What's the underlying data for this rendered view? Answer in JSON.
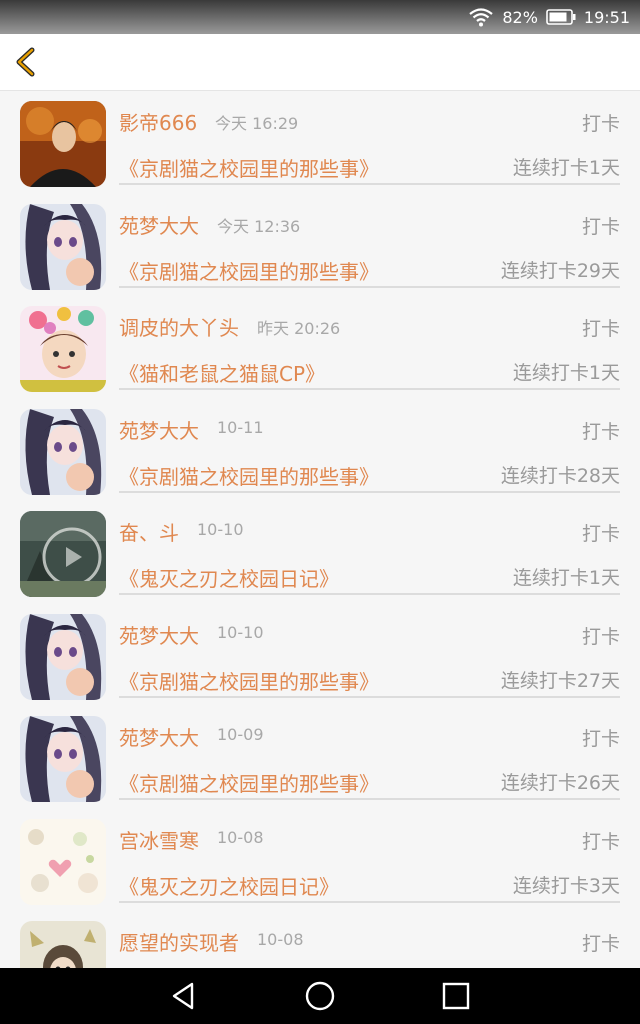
{
  "status": {
    "battery": "82%",
    "time": "19:51"
  },
  "header": {
    "back_icon": "chevron-left-icon",
    "accent": "#e8a000"
  },
  "rows": [
    {
      "name": "影帝666",
      "time": "今天 16:29",
      "action": "打卡",
      "book": "《京剧猫之校园里的那些事》",
      "streak": "连续打卡1天",
      "avatar": "photo-man"
    },
    {
      "name": "苑梦大大",
      "time": "今天 12:36",
      "action": "打卡",
      "book": "《京剧猫之校园里的那些事》",
      "streak": "连续打卡29天",
      "avatar": "anime-girl"
    },
    {
      "name": "调皮的大丫头",
      "time": "昨天 20:26",
      "action": "打卡",
      "book": "《猫和老鼠之猫鼠CP》",
      "streak": "连续打卡1天",
      "avatar": "flower-girl"
    },
    {
      "name": "苑梦大大",
      "time": "10-11",
      "action": "打卡",
      "book": "《京剧猫之校园里的那些事》",
      "streak": "连续打卡28天",
      "avatar": "anime-girl"
    },
    {
      "name": "奋、斗",
      "time": "10-10",
      "action": "打卡",
      "book": "《鬼灭之刃之校园日记》",
      "streak": "连续打卡1天",
      "avatar": "dark-photo"
    },
    {
      "name": "苑梦大大",
      "time": "10-10",
      "action": "打卡",
      "book": "《京剧猫之校园里的那些事》",
      "streak": "连续打卡27天",
      "avatar": "anime-girl"
    },
    {
      "name": "苑梦大大",
      "time": "10-09",
      "action": "打卡",
      "book": "《京剧猫之校园里的那些事》",
      "streak": "连续打卡26天",
      "avatar": "anime-girl"
    },
    {
      "name": "宫冰雪寒",
      "time": "10-08",
      "action": "打卡",
      "book": "《鬼灭之刃之校园日记》",
      "streak": "连续打卡3天",
      "avatar": "cute-pattern"
    },
    {
      "name": "愿望的实现者",
      "time": "10-08",
      "action": "打卡",
      "book": "",
      "streak": "",
      "avatar": "chibi-drawing"
    }
  ],
  "navbar": {
    "icons": [
      "back-triangle-icon",
      "home-circle-icon",
      "recents-square-icon"
    ]
  }
}
